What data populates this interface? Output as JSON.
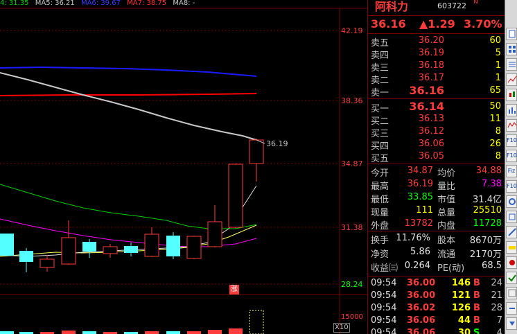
{
  "ma_legend": {
    "ma4": "4: 31.35",
    "ma5": "MA5: 36.21",
    "ma6": "MA6: 39.67",
    "ma7": "MA7: 38.75",
    "ma8": "MA8: -"
  },
  "chart": {
    "y_ticks": [
      "42.19",
      "38.36",
      "34.87",
      "31.38",
      "28.24"
    ],
    "last_price_label": "36.19",
    "limit_tag": "涨",
    "volume_scale": "15000",
    "volume_unit": "X10",
    "colors": {
      "up": "#ff3c3c",
      "down": "#54ffff",
      "ma_white": "#c8c8c8",
      "ma_yellow": "#ffff64",
      "ma_magenta": "#ff00ff",
      "ma_green": "#00d000",
      "ma_blue": "#1a1aff",
      "ma_red": "#ff0000"
    }
  },
  "quote": {
    "name": "阿科力",
    "code": "603722",
    "flag": "N",
    "price": "36.16",
    "change": "▲1.29",
    "change_pct": "3.70%",
    "asks": [
      {
        "label": "卖五",
        "price": "36.20",
        "vol": "60"
      },
      {
        "label": "卖四",
        "price": "36.19",
        "vol": "5"
      },
      {
        "label": "卖三",
        "price": "36.18",
        "vol": "1"
      },
      {
        "label": "卖二",
        "price": "36.17",
        "vol": "1"
      },
      {
        "label": "卖一",
        "price": "36.16",
        "vol": "65"
      }
    ],
    "bids": [
      {
        "label": "买一",
        "price": "36.14",
        "vol": "50"
      },
      {
        "label": "买二",
        "price": "36.13",
        "vol": "11"
      },
      {
        "label": "买三",
        "price": "36.12",
        "vol": "8"
      },
      {
        "label": "买四",
        "price": "36.06",
        "vol": "26"
      },
      {
        "label": "买五",
        "price": "36.05",
        "vol": "8"
      }
    ],
    "stats": [
      {
        "l1": "今开",
        "v1": "34.87",
        "c1": "#ff3c3c",
        "l2": "均价",
        "v2": "34.88",
        "c2": "#ff3c3c"
      },
      {
        "l1": "最高",
        "v1": "36.19",
        "c1": "#ff3c3c",
        "l2": "量比",
        "v2": "7.38",
        "c2": "#ff00ff"
      },
      {
        "l1": "最低",
        "v1": "33.85",
        "c1": "#00ff00",
        "l2": "市值",
        "v2": "31.4亿",
        "c2": "#e0e0e0"
      },
      {
        "l1": "现量",
        "v1": "111",
        "c1": "#ffff00",
        "l2": "总量",
        "v2": "25510",
        "c2": "#ffff00"
      },
      {
        "l1": "外盘",
        "v1": "13782",
        "c1": "#ff3c3c",
        "l2": "内盘",
        "v2": "11728",
        "c2": "#00ff00"
      }
    ],
    "stats2": [
      {
        "l1": "换手",
        "v1": "11.76%",
        "l2": "股本",
        "v2": "8670万"
      },
      {
        "l1": "净资",
        "v1": "5.86",
        "l2": "流通",
        "v2": "2170万"
      },
      {
        "l1": "收益㈢",
        "v1": "0.264",
        "l2": "PE(动)",
        "v2": "68.5"
      }
    ],
    "ticks": [
      {
        "time": "09:54",
        "price": "36.00",
        "vol": "146",
        "side": "B",
        "n": "24"
      },
      {
        "time": "09:54",
        "price": "36.00",
        "vol": "121",
        "side": "B",
        "n": "21"
      },
      {
        "time": "09:54",
        "price": "36.02",
        "vol": "126",
        "side": "B",
        "n": "28"
      },
      {
        "time": "09:54",
        "price": "36.06",
        "vol": "44",
        "side": "B",
        "n": "7"
      },
      {
        "time": "09:54",
        "price": "36.06",
        "vol": "30",
        "side": "S",
        "n": "4"
      }
    ]
  },
  "toolbar": {
    "buttons": [
      "F10",
      "F10",
      "Fiz",
      "F10"
    ]
  }
}
